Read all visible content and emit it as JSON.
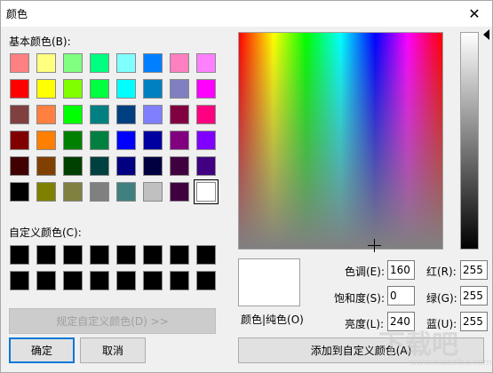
{
  "window": {
    "title": "颜色",
    "close_glyph": "✕"
  },
  "basic": {
    "label": "基本颜色(B):",
    "selected_index": 47,
    "colors": [
      "#ff8080",
      "#ffff80",
      "#80ff80",
      "#00ff80",
      "#80ffff",
      "#0080ff",
      "#ff80c0",
      "#ff80ff",
      "#ff0000",
      "#ffff00",
      "#80ff00",
      "#00ff40",
      "#00ffff",
      "#0080c0",
      "#8080c0",
      "#ff00ff",
      "#804040",
      "#ff8040",
      "#00ff00",
      "#008080",
      "#004080",
      "#8080ff",
      "#800040",
      "#ff0080",
      "#800000",
      "#ff8000",
      "#008000",
      "#008040",
      "#0000ff",
      "#0000a0",
      "#800080",
      "#8000ff",
      "#400000",
      "#804000",
      "#004000",
      "#004040",
      "#000080",
      "#000040",
      "#400040",
      "#400080",
      "#000000",
      "#808000",
      "#808040",
      "#808080",
      "#408080",
      "#c0c0c0",
      "#400040",
      "#ffffff"
    ]
  },
  "custom": {
    "label": "自定义颜色(C):",
    "colors": [
      "#000000",
      "#000000",
      "#000000",
      "#000000",
      "#000000",
      "#000000",
      "#000000",
      "#000000",
      "#000000",
      "#000000",
      "#000000",
      "#000000",
      "#000000",
      "#000000",
      "#000000",
      "#000000"
    ]
  },
  "buttons": {
    "define_custom": "规定自定义颜色(D) >>",
    "ok": "确定",
    "cancel": "取消",
    "add_custom": "添加到自定义颜色(A)"
  },
  "preview": {
    "label": "颜色|纯色(O)",
    "color": "#ffffff"
  },
  "fields": {
    "hue": {
      "label": "色调(E):",
      "value": "160"
    },
    "sat": {
      "label": "饱和度(S):",
      "value": "0"
    },
    "lum": {
      "label": "亮度(L):",
      "value": "240"
    },
    "red": {
      "label": "红(R):",
      "value": "255"
    },
    "green": {
      "label": "绿(G):",
      "value": "255"
    },
    "blue": {
      "label": "蓝(U):",
      "value": "255"
    }
  },
  "watermark": {
    "main": "下载吧",
    "sub": "www.xiazaiba.com"
  }
}
